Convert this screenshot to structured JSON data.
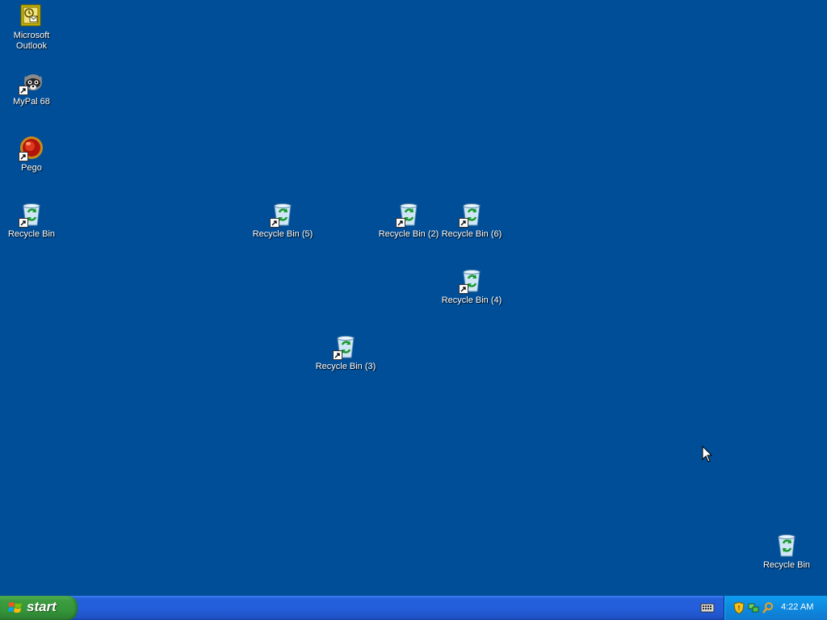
{
  "desktop_icons": [
    {
      "label": "Microsoft Outlook",
      "icon": "outlook-icon"
    },
    {
      "label": "MyPal 68",
      "icon": "mypal-icon"
    },
    {
      "label": "Pego",
      "icon": "pego-icon"
    },
    {
      "label": "Recycle Bin",
      "icon": "recycle-bin-icon"
    },
    {
      "label": "Recycle Bin (5)",
      "icon": "recycle-bin-icon"
    },
    {
      "label": "Recycle Bin (2)",
      "icon": "recycle-bin-icon"
    },
    {
      "label": "Recycle Bin (6)",
      "icon": "recycle-bin-icon"
    },
    {
      "label": "Recycle Bin (4)",
      "icon": "recycle-bin-icon"
    },
    {
      "label": "Recycle Bin (3)",
      "icon": "recycle-bin-icon"
    },
    {
      "label": "Recycle Bin",
      "icon": "recycle-bin-icon"
    }
  ],
  "taskbar": {
    "start_label": "start",
    "clock": "4:22 AM",
    "tray_icons": [
      "security-shield-icon",
      "network-icon",
      "search-icon"
    ],
    "keyboard_icon": "keyboard-icon"
  },
  "colors": {
    "desktop_bg": "#004e98",
    "taskbar_blue": "#245edb",
    "start_green": "#3c9c3f",
    "tray_blue": "#0d8ade"
  }
}
